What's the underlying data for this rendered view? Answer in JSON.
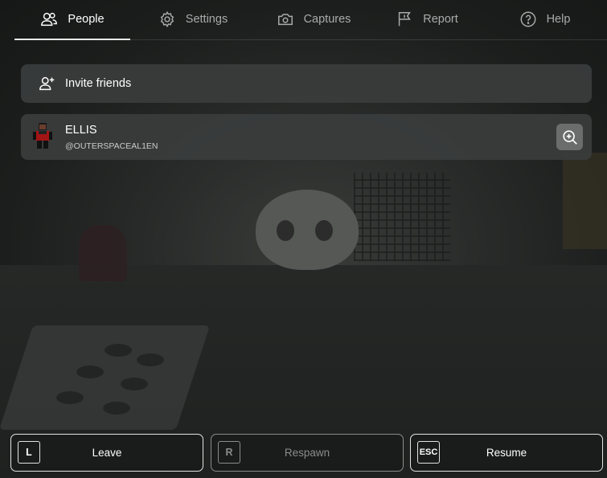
{
  "nav": {
    "tabs": [
      {
        "label": "People",
        "icon": "people-icon",
        "active": true
      },
      {
        "label": "Settings",
        "icon": "gear-icon",
        "active": false
      },
      {
        "label": "Captures",
        "icon": "camera-icon",
        "active": false
      },
      {
        "label": "Report",
        "icon": "flag-icon",
        "active": false
      },
      {
        "label": "Help",
        "icon": "help-icon",
        "active": false
      }
    ]
  },
  "invite": {
    "label": "Invite friends",
    "icon": "add-friend-icon"
  },
  "players": [
    {
      "name": "ELLIS",
      "handle": "@OUTERSPACEAL1EN",
      "action_icon": "zoom-in-icon"
    }
  ],
  "bottom_bar": {
    "leave": {
      "key": "L",
      "label": "Leave"
    },
    "respawn": {
      "key": "R",
      "label": "Respawn",
      "disabled": true
    },
    "resume": {
      "key": "ESC",
      "label": "Resume"
    }
  },
  "colors": {
    "card_bg": "#3a3c3c",
    "text_active": "#ffffff",
    "text_inactive": "#a9abab",
    "disabled": "#8a8c8c"
  }
}
